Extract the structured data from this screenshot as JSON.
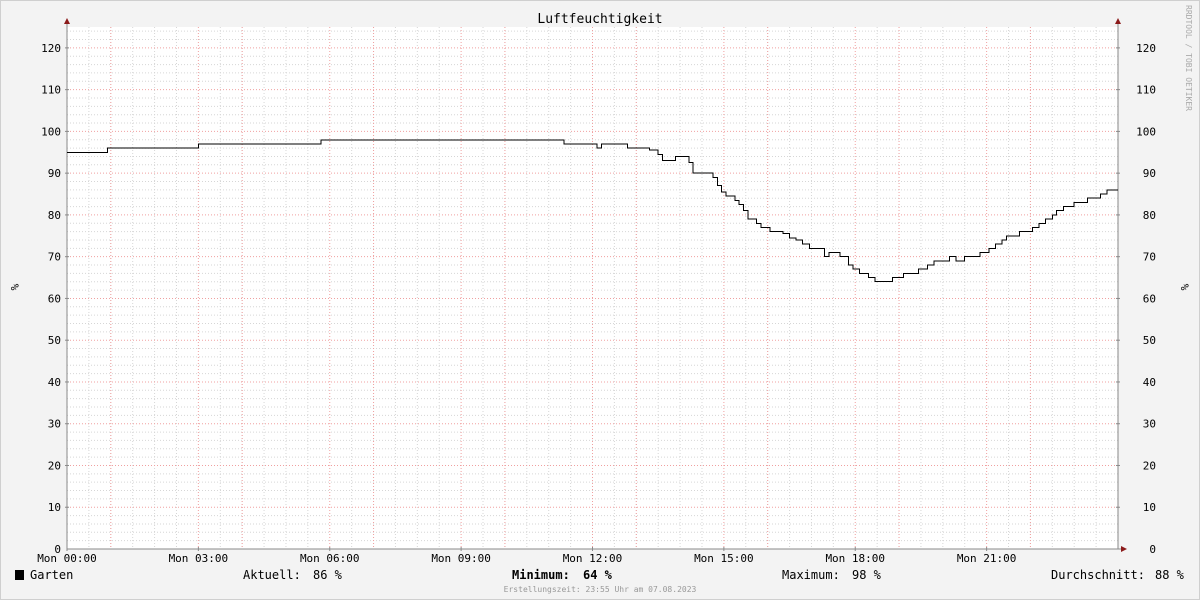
{
  "chart_data": {
    "type": "line",
    "title": "Luftfeuchtigkeit",
    "ylabel": "%",
    "ylim": [
      0,
      125
    ],
    "y_ticks": [
      "0",
      "10",
      "20",
      "30",
      "40",
      "50",
      "60",
      "70",
      "80",
      "90",
      "100",
      "110",
      "120"
    ],
    "x_range_hours": [
      0,
      24
    ],
    "x_ticks": [
      "Mon 00:00",
      "Mon 03:00",
      "Mon 06:00",
      "Mon 09:00",
      "Mon 12:00",
      "Mon 15:00",
      "Mon 18:00",
      "Mon 21:00"
    ],
    "grid": true,
    "watermark": "RRDTOOL / TOBI OETIKER",
    "series": [
      {
        "name": "Garten",
        "color": "#000000",
        "step": true,
        "points": [
          [
            0,
            95
          ],
          [
            0.92,
            96
          ],
          [
            3.0,
            97
          ],
          [
            5.8,
            98
          ],
          [
            11.35,
            97
          ],
          [
            12.1,
            96
          ],
          [
            12.2,
            97
          ],
          [
            12.8,
            96
          ],
          [
            13.3,
            95.5
          ],
          [
            13.5,
            94.5
          ],
          [
            13.6,
            93
          ],
          [
            13.9,
            94
          ],
          [
            14.2,
            92.5
          ],
          [
            14.3,
            90
          ],
          [
            14.75,
            89
          ],
          [
            14.85,
            87
          ],
          [
            14.95,
            85.5
          ],
          [
            15.05,
            84.5
          ],
          [
            15.25,
            83.5
          ],
          [
            15.35,
            82.5
          ],
          [
            15.45,
            81
          ],
          [
            15.55,
            79
          ],
          [
            15.75,
            78
          ],
          [
            15.85,
            77
          ],
          [
            16.05,
            76
          ],
          [
            16.35,
            75.5
          ],
          [
            16.5,
            74.5
          ],
          [
            16.65,
            74
          ],
          [
            16.8,
            73
          ],
          [
            16.95,
            72
          ],
          [
            17.3,
            70
          ],
          [
            17.4,
            71
          ],
          [
            17.65,
            70
          ],
          [
            17.85,
            68
          ],
          [
            17.95,
            67
          ],
          [
            18.1,
            66
          ],
          [
            18.3,
            65
          ],
          [
            18.45,
            64
          ],
          [
            18.85,
            65
          ],
          [
            19.1,
            66
          ],
          [
            19.45,
            67
          ],
          [
            19.65,
            68
          ],
          [
            19.8,
            69
          ],
          [
            20.15,
            70
          ],
          [
            20.3,
            69
          ],
          [
            20.5,
            70
          ],
          [
            20.85,
            71
          ],
          [
            21.05,
            72
          ],
          [
            21.2,
            73
          ],
          [
            21.35,
            74
          ],
          [
            21.45,
            75
          ],
          [
            21.75,
            76
          ],
          [
            22.05,
            77
          ],
          [
            22.2,
            78
          ],
          [
            22.35,
            79
          ],
          [
            22.5,
            80
          ],
          [
            22.6,
            81
          ],
          [
            22.75,
            82
          ],
          [
            23.0,
            83
          ],
          [
            23.3,
            84
          ],
          [
            23.6,
            85
          ],
          [
            23.75,
            86
          ],
          [
            24,
            86
          ]
        ]
      }
    ]
  },
  "legend": {
    "series_name": "Garten",
    "series_color": "#000000",
    "current_label": "Aktuell:",
    "current_value": "86 %",
    "minimum_label": "Minimum:",
    "minimum_value": "64 %",
    "maximum_label": "Maximum:",
    "maximum_value": "98 %",
    "average_label": "Durchschnitt:",
    "average_value": "88 %"
  },
  "footer": "Erstellungszeit: 23:55 Uhr am 07.08.2023"
}
